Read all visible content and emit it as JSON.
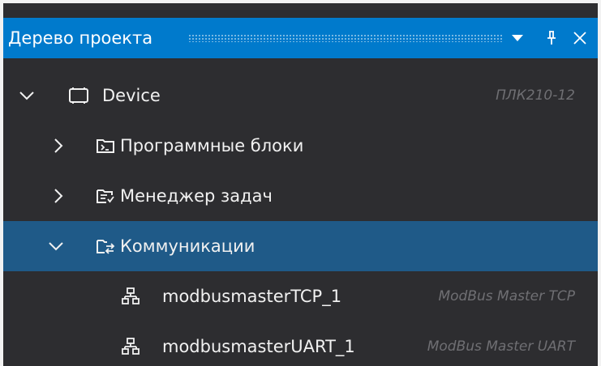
{
  "panel": {
    "title": "Дерево проекта",
    "buttons": [
      {
        "name": "dropdown",
        "icon": "caret-down-icon"
      },
      {
        "name": "pin",
        "icon": "pin-icon"
      },
      {
        "name": "close",
        "icon": "close-icon"
      }
    ]
  },
  "tree": {
    "items": [
      {
        "label": "Device",
        "meta": "ПЛК210-12",
        "expanded": true,
        "icon": "device-icon",
        "level": 0
      },
      {
        "label": "Программные блоки",
        "expanded": false,
        "icon": "program-blocks-icon",
        "level": 1
      },
      {
        "label": "Менеджер задач",
        "expanded": false,
        "icon": "task-manager-icon",
        "level": 1
      },
      {
        "label": "Коммуникации",
        "expanded": true,
        "selected": true,
        "icon": "communications-icon",
        "level": 1
      },
      {
        "label": "modbusmasterTCP_1",
        "meta": "ModBus Master TCP",
        "icon": "network-icon",
        "level": 2
      },
      {
        "label": "modbusmasterUART_1",
        "meta": "ModBus Master UART",
        "icon": "network-icon",
        "level": 2
      }
    ]
  },
  "colors": {
    "titlebar": "#007acc",
    "background": "#2d2d30",
    "selection": "#1f5a88",
    "meta_text": "#6f6f73"
  }
}
